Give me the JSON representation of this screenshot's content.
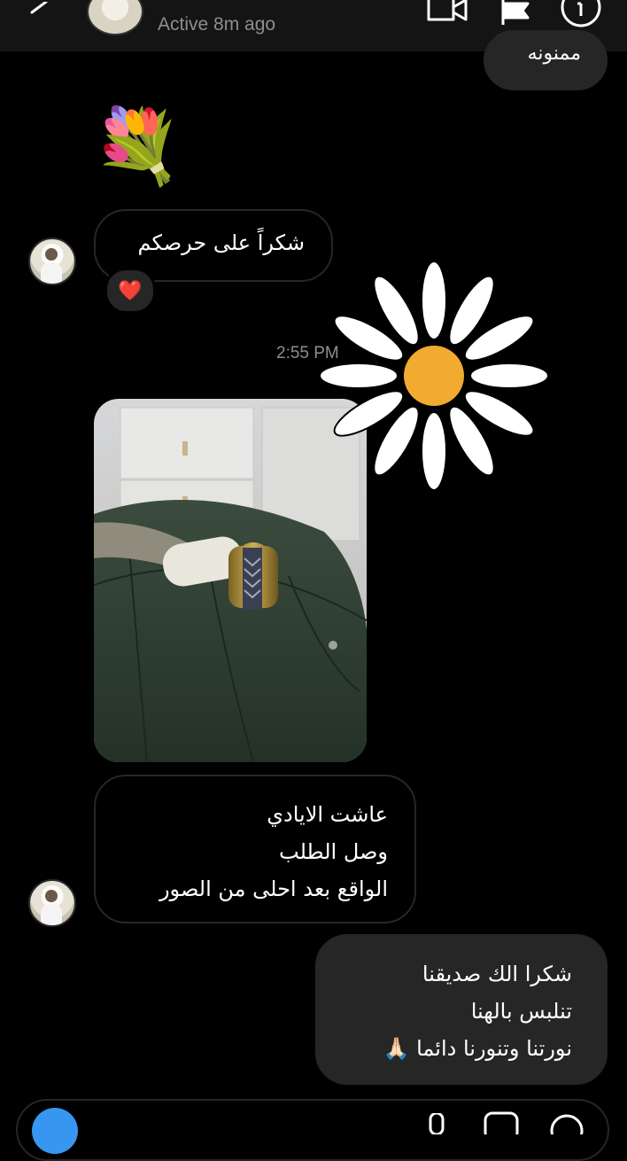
{
  "header": {
    "status": "Active 8m ago",
    "icons": [
      "back-icon",
      "video-call-icon",
      "flag-icon",
      "info-icon"
    ]
  },
  "messages": {
    "partial_top": "ممنونه",
    "flowers_emoji": "💐",
    "thanks_received": "شكراً على حرصكم",
    "reaction": "❤️",
    "timestamp": "2:55 PM",
    "received_text": {
      "line1": "عاشت الايادي",
      "line2": "وصل الطلب",
      "line3": "الواقع بعد احلى من الصور"
    },
    "sent_text": {
      "line1": "شكرا الك صديقنا",
      "line2": "تنلبس بالهنا",
      "line3": "نورتنا وتنورنا دائما 🙏🏻"
    }
  },
  "sticker": {
    "name": "daisy-sticker",
    "petal_color": "#ffffff",
    "center_color": "#f0ab30"
  },
  "colors": {
    "background": "#000000",
    "sent_bubble": "#262626",
    "outline": "#262626",
    "accent": "#3797f0"
  }
}
